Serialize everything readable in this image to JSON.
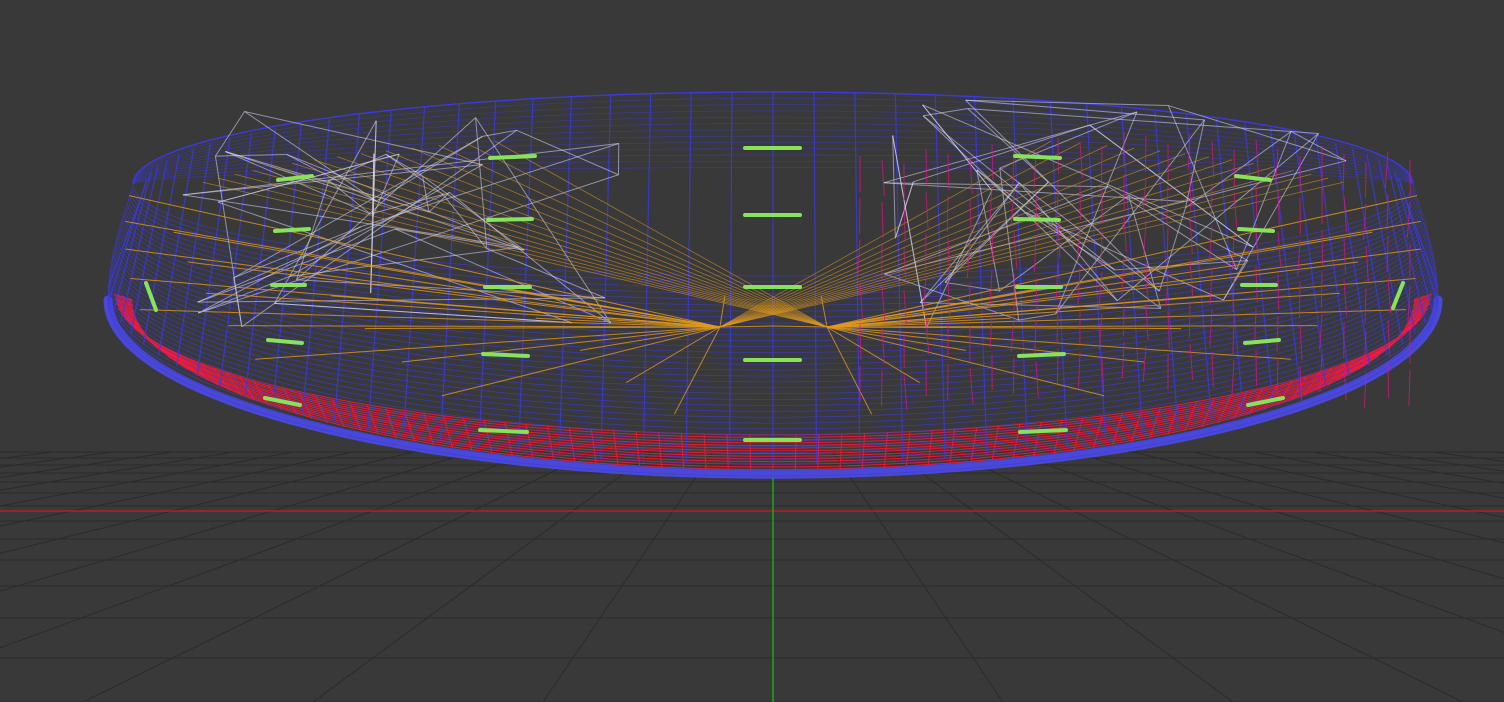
{
  "viewport": {
    "kind": "3d-wireframe-viewport",
    "colors": {
      "background": "#393939",
      "grid": "#2b2b2b",
      "x_axis": "#c81e1e",
      "y_axis": "#1fa51f",
      "mesh_blue": "#3a3adf",
      "mesh_rim": "#4a48d6",
      "mesh_red": "#ff1a2e",
      "mesh_white": "#d9dcff",
      "mesh_orange": "#e29a1a",
      "mesh_magenta": "#e0148a",
      "selected_edges": "#86e35a"
    },
    "object": {
      "shape": "shallow dish / disc mesh in wireframe",
      "icons": {
        "grid": "ground-grid",
        "axes": "world-axes"
      }
    }
  }
}
